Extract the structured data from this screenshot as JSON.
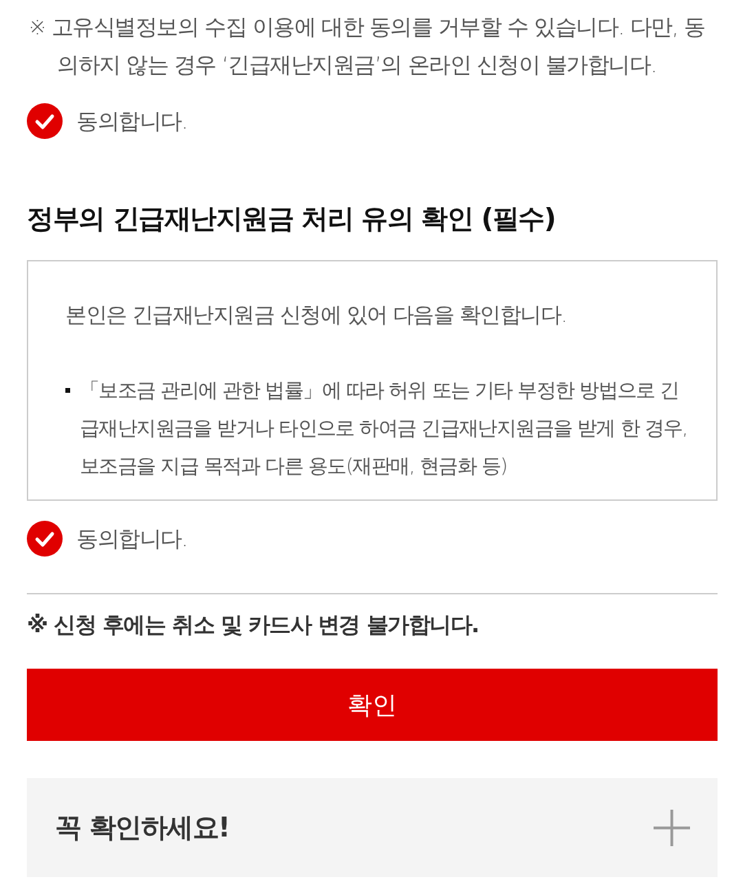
{
  "notice": {
    "text": "※ 고유식별정보의 수집 이용에 대한 동의를 거부할 수 있습니다. 다만, 동의하지 않는 경우 ‘긴급재난지원금’의 온라인 신청이 불가합니다."
  },
  "consent_1": {
    "label": "동의합니다.",
    "checked": true
  },
  "section": {
    "title": "정부의 긴급재난지원금 처리 유의 확인 (필수)",
    "intro": "본인은 긴급재난지원금 신청에 있어 다음을 확인합니다.",
    "bullets": [
      "「보조금 관리에 관한 법률」에 따라 허위 또는 기타 부정한 방법으로 긴급재난지원금을 받거나 타인으로 하여금 긴급재난지원금을 받게 한 경우, 보조금을 지급 목적과 다른 용도(재판매, 현금화 등)"
    ]
  },
  "consent_2": {
    "label": "동의합니다.",
    "checked": true
  },
  "warning": {
    "text": "※ 신청 후에는 취소 및 카드사 변경 불가합니다."
  },
  "confirm_button": {
    "label": "확인"
  },
  "accordion": {
    "title": "꼭 확인하세요!",
    "expanded": false
  }
}
